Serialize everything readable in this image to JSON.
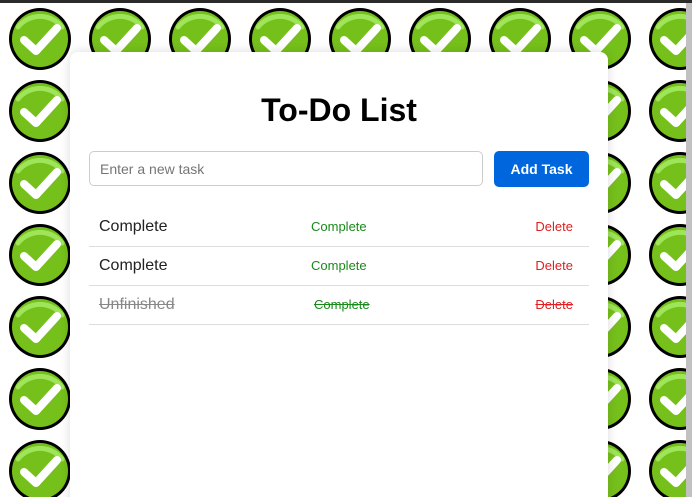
{
  "page": {
    "title": "To-Do List",
    "background_icon": "checkmark-circle-icon",
    "colors": {
      "add_button": "#0066dd",
      "complete_action": "#1a8a1a",
      "delete_action": "#e02020",
      "background_icon": "#76c01b"
    }
  },
  "input": {
    "placeholder": "Enter a new task",
    "value": ""
  },
  "add_button": {
    "label": "Add Task"
  },
  "tasks": [
    {
      "text": "Complete",
      "complete_label": "Complete",
      "delete_label": "Delete",
      "completed": false
    },
    {
      "text": "Complete",
      "complete_label": "Complete",
      "delete_label": "Delete",
      "completed": false
    },
    {
      "text": "Unfinished",
      "complete_label": "Complete",
      "delete_label": "Delete",
      "completed": true
    }
  ]
}
